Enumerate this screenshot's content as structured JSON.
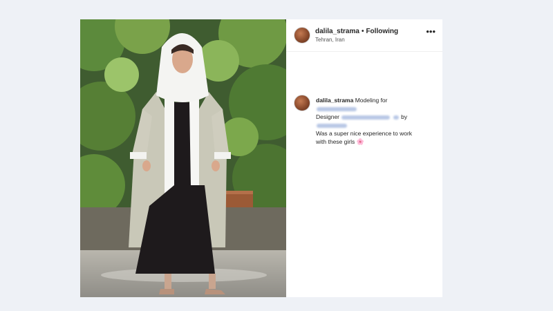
{
  "post": {
    "username": "dalila_strama",
    "follow_status": "Following",
    "separator": "•",
    "location": "Tehran, Iran",
    "more_label": "•••",
    "caption": {
      "username": "dalila_strama",
      "line1": "Modeling for",
      "line2_prefix": "Designer",
      "line2_suffix": "by",
      "line3": "Was a super nice experience to work",
      "line4": "with these girls",
      "emoji": "🌸"
    }
  },
  "icons": {
    "avatar": "avatar-image",
    "more": "more-options-icon",
    "emoji": "flower-emoji"
  },
  "colors": {
    "background": "#eef1f6",
    "text": "#262626",
    "blurred_mention": "#b9c8e6"
  }
}
